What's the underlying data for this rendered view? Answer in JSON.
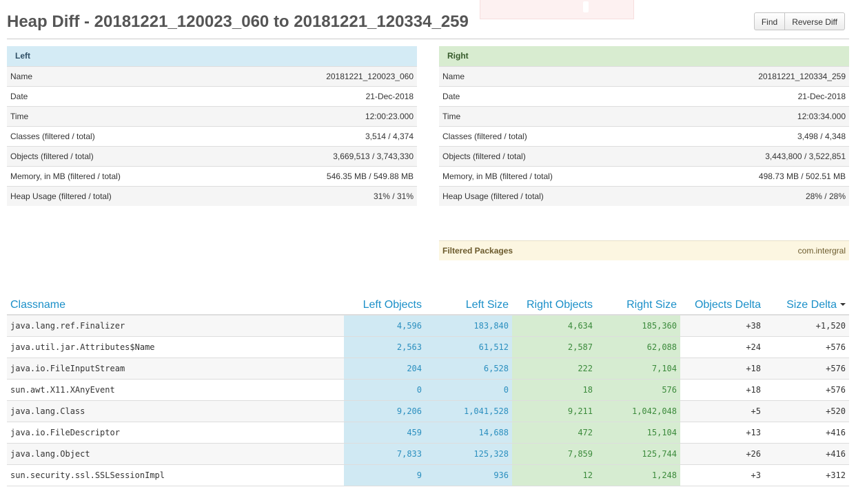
{
  "header": {
    "title": "Heap Diff - 20181221_120023_060 to 20181221_120334_259",
    "find_label": "Find",
    "reverse_label": "Reverse Diff"
  },
  "left": {
    "heading": "Left",
    "rows": [
      {
        "label": "Name",
        "value": "20181221_120023_060"
      },
      {
        "label": "Date",
        "value": "21-Dec-2018"
      },
      {
        "label": "Time",
        "value": "12:00:23.000"
      },
      {
        "label": "Classes (filtered / total)",
        "value": "3,514 / 4,374"
      },
      {
        "label": "Objects (filtered / total)",
        "value": "3,669,513 / 3,743,330"
      },
      {
        "label": "Memory, in MB (filtered / total)",
        "value": "546.35 MB / 549.88 MB"
      },
      {
        "label": "Heap Usage (filtered / total)",
        "value": "31% / 31%"
      }
    ]
  },
  "right": {
    "heading": "Right",
    "rows": [
      {
        "label": "Name",
        "value": "20181221_120334_259"
      },
      {
        "label": "Date",
        "value": "21-Dec-2018"
      },
      {
        "label": "Time",
        "value": "12:03:34.000"
      },
      {
        "label": "Classes (filtered / total)",
        "value": "3,498 / 4,348"
      },
      {
        "label": "Objects (filtered / total)",
        "value": "3,443,800 / 3,522,851"
      },
      {
        "label": "Memory, in MB (filtered / total)",
        "value": "498.73 MB / 502.51 MB"
      },
      {
        "label": "Heap Usage (filtered / total)",
        "value": "28% / 28%"
      }
    ]
  },
  "filtered": {
    "label": "Filtered Packages",
    "value": "com.intergral"
  },
  "table": {
    "headers": {
      "classname": "Classname",
      "left_objects": "Left Objects",
      "left_size": "Left Size",
      "right_objects": "Right Objects",
      "right_size": "Right Size",
      "objects_delta": "Objects Delta",
      "size_delta": "Size Delta"
    },
    "sort_icon": "caret-down-icon",
    "rows": [
      {
        "classname": "java.lang.ref.Finalizer",
        "left_objects": "4,596",
        "left_size": "183,840",
        "right_objects": "4,634",
        "right_size": "185,360",
        "objects_delta": "+38",
        "size_delta": "+1,520"
      },
      {
        "classname": "java.util.jar.Attributes$Name",
        "left_objects": "2,563",
        "left_size": "61,512",
        "right_objects": "2,587",
        "right_size": "62,088",
        "objects_delta": "+24",
        "size_delta": "+576"
      },
      {
        "classname": "java.io.FileInputStream",
        "left_objects": "204",
        "left_size": "6,528",
        "right_objects": "222",
        "right_size": "7,104",
        "objects_delta": "+18",
        "size_delta": "+576"
      },
      {
        "classname": "sun.awt.X11.XAnyEvent",
        "left_objects": "0",
        "left_size": "0",
        "right_objects": "18",
        "right_size": "576",
        "objects_delta": "+18",
        "size_delta": "+576"
      },
      {
        "classname": "java.lang.Class",
        "left_objects": "9,206",
        "left_size": "1,041,528",
        "right_objects": "9,211",
        "right_size": "1,042,048",
        "objects_delta": "+5",
        "size_delta": "+520"
      },
      {
        "classname": "java.io.FileDescriptor",
        "left_objects": "459",
        "left_size": "14,688",
        "right_objects": "472",
        "right_size": "15,104",
        "objects_delta": "+13",
        "size_delta": "+416"
      },
      {
        "classname": "java.lang.Object",
        "left_objects": "7,833",
        "left_size": "125,328",
        "right_objects": "7,859",
        "right_size": "125,744",
        "objects_delta": "+26",
        "size_delta": "+416"
      },
      {
        "classname": "sun.security.ssl.SSLSessionImpl",
        "left_objects": "9",
        "left_size": "936",
        "right_objects": "12",
        "right_size": "1,248",
        "objects_delta": "+3",
        "size_delta": "+312"
      }
    ]
  }
}
